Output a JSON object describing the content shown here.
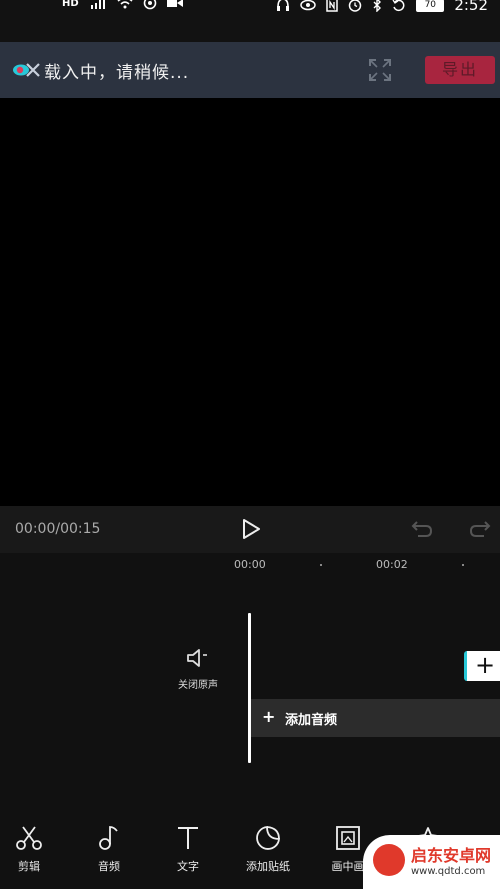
{
  "status_bar": {
    "left_icons": [
      "hd-icon",
      "signal-icon",
      "wifi-icon",
      "sync-icon",
      "video-icon"
    ],
    "right_icons": [
      "headset-icon",
      "eye-icon",
      "nfc-icon",
      "alarm-icon",
      "bluetooth-icon",
      "rotate-icon"
    ],
    "hd_label": "HD",
    "battery": "70",
    "time": "2:52"
  },
  "header": {
    "loading_text": "载入中，请稍候...",
    "export_label": "导出",
    "export_color": "#a8253f"
  },
  "playback": {
    "timecode": "00:00/00:15"
  },
  "timeline": {
    "ruler_labels": [
      "00:00",
      "00:02"
    ],
    "mute_label": "关闭原声",
    "add_audio_plus": "+",
    "add_audio_label": "添加音频",
    "add_clip_plus": "+",
    "accent_color": "#28c8d8"
  },
  "toolbar": {
    "items": [
      {
        "label": "剪辑",
        "icon": "scissors-icon"
      },
      {
        "label": "音频",
        "icon": "music-note-icon"
      },
      {
        "label": "文字",
        "icon": "text-icon"
      },
      {
        "label": "添加贴纸",
        "icon": "sticker-icon"
      },
      {
        "label": "画中画",
        "icon": "picture-in-picture-icon"
      },
      {
        "label": "",
        "icon": "effects-icon"
      }
    ]
  },
  "watermark": {
    "title": "启东安卓网",
    "url": "www.qdtd.com"
  }
}
